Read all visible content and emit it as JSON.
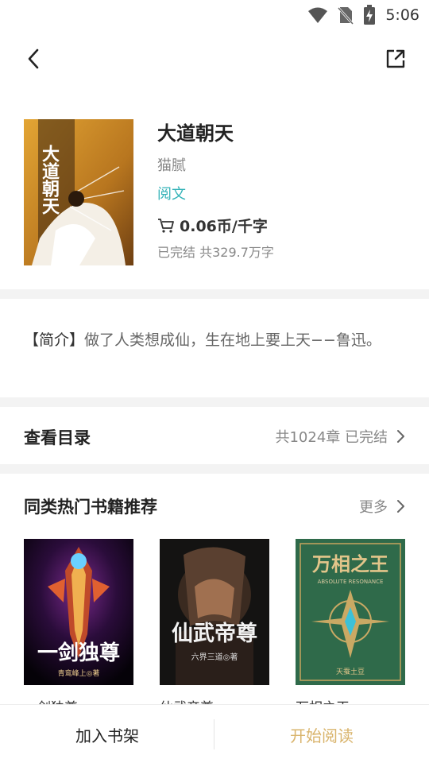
{
  "status_bar": {
    "time": "5:06",
    "icons": [
      "wifi-icon",
      "no-sim-icon",
      "battery-charging-icon"
    ]
  },
  "nav": {
    "back_icon": "chevron-left-icon",
    "share_icon": "share-icon"
  },
  "book": {
    "title": "大道朝天",
    "cover_title": "大道朝天",
    "author": "猫腻",
    "source": "阅文",
    "price": "0.06币/千字",
    "status": "已完结 共329.7万字"
  },
  "intro": {
    "label": "【简介】",
    "text": "做了人类想成仙，生在地上要上天−−鲁迅。"
  },
  "toc": {
    "title": "查看目录",
    "meta": "共1024章 已完结"
  },
  "recommend": {
    "title": "同类热门书籍推荐",
    "more": "更多",
    "books": [
      {
        "name": "一剑独尊",
        "cover_title": "一剑独尊",
        "cover_author": "青鸾峰上◎著"
      },
      {
        "name": "仙武帝尊",
        "cover_title": "仙武帝尊",
        "cover_author": "六界三道◎著"
      },
      {
        "name": "万相之王",
        "cover_title": "万相之王",
        "cover_subtitle": "ABSOLUTE RESONANCE",
        "cover_author": "天蚕土豆"
      }
    ]
  },
  "bottom": {
    "add_shelf": "加入书架",
    "start_read": "开始阅读"
  },
  "colors": {
    "accent_teal": "#35b3b8",
    "read_button": "#d9b46c",
    "section_gap": "#f3f3f3"
  }
}
